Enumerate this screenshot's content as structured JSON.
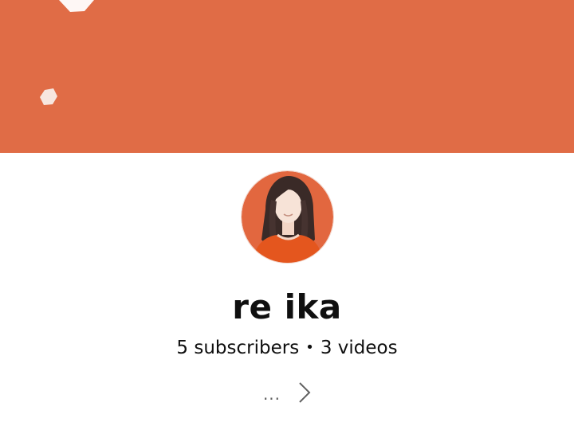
{
  "banner": {
    "color": "#e06c46",
    "icon": "banner-art"
  },
  "channel": {
    "name": "re ika",
    "subscribers": "5 subscribers",
    "separator": "•",
    "videos": "3 videos",
    "avatar_icon": "avatar",
    "avatar_bg": "#e2673f"
  },
  "description": {
    "ellipsis": "...",
    "more_icon": "chevron-right-icon"
  }
}
